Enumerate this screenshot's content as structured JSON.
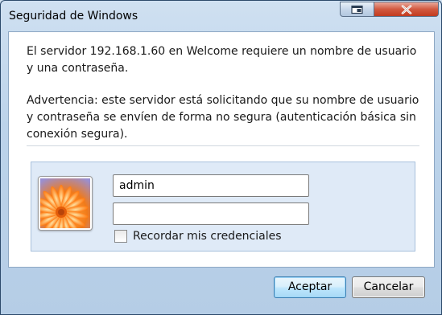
{
  "window": {
    "title": "Seguridad de Windows"
  },
  "message": {
    "line1": "El servidor 192.168.1.60 en Welcome requiere un nombre de usuario y una contraseña.",
    "warning": "Advertencia: este servidor está solicitando que su nombre de usuario y contraseña se envíen de forma no segura (autenticación básica sin conexión segura)."
  },
  "credentials": {
    "username_value": "admin",
    "password_value": "",
    "remember_label": "Recordar mis credenciales",
    "remember_checked": false,
    "avatar_icon": "flower-user-tile-icon"
  },
  "buttons": {
    "ok_label": "Aceptar",
    "cancel_label": "Cancelar"
  },
  "colors": {
    "close_button": "#c23b1f",
    "panel_bg": "#dfeaf7",
    "default_button_border": "#3c7fb1"
  }
}
